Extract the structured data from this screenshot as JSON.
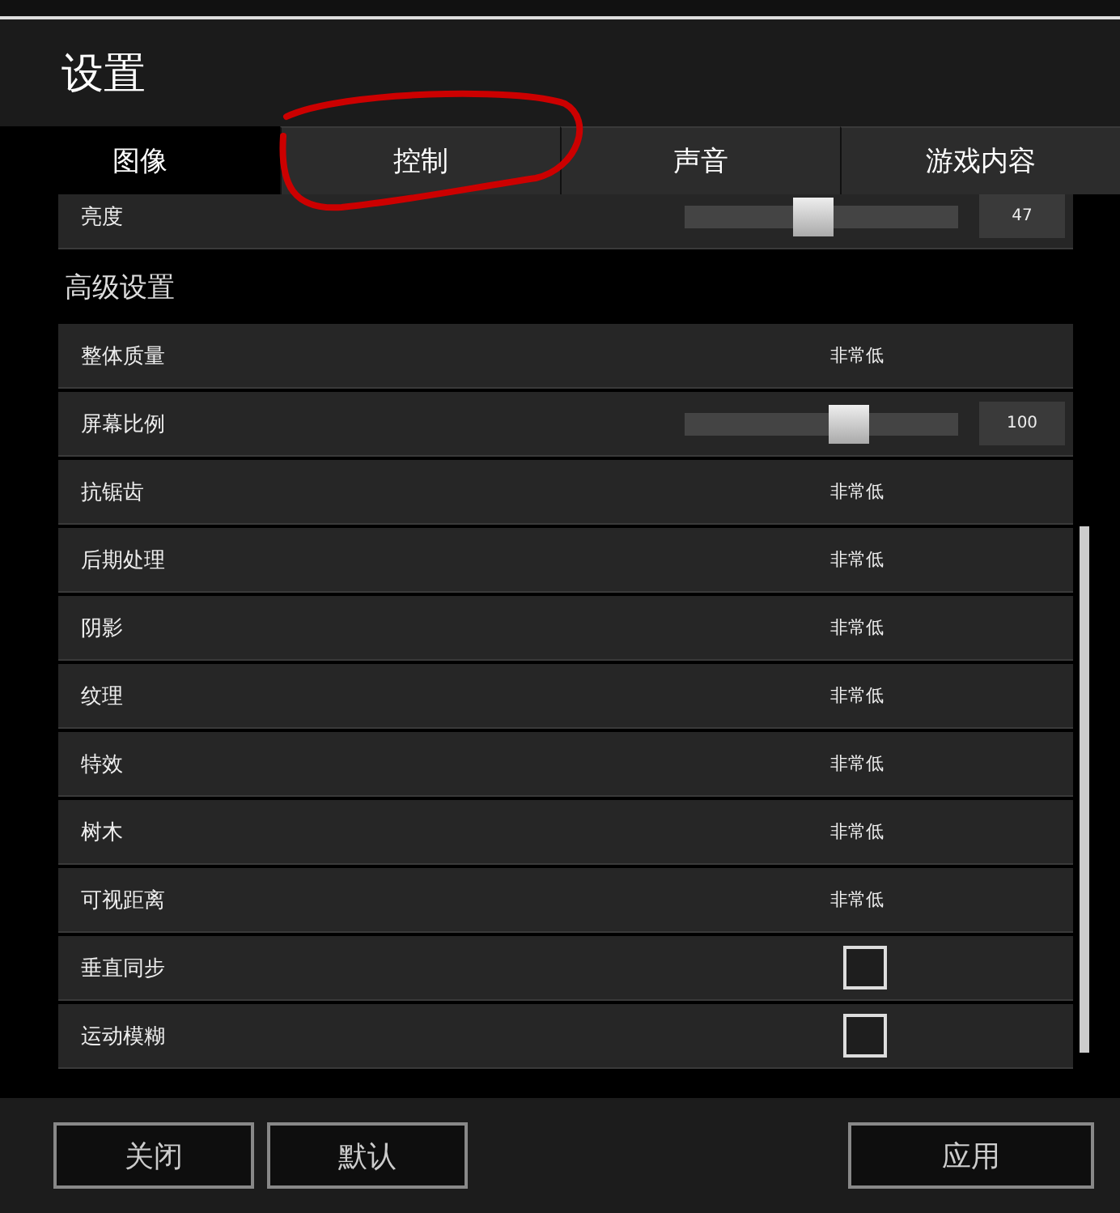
{
  "window": {
    "title": "设置"
  },
  "tabs": [
    {
      "label": "图像",
      "selected": true,
      "circled": false
    },
    {
      "label": "控制",
      "selected": false,
      "circled": true
    },
    {
      "label": "声音",
      "selected": false,
      "circled": false
    },
    {
      "label": "游戏内容",
      "selected": false,
      "circled": false
    }
  ],
  "settings": [
    {
      "kind": "slider",
      "name": "亮度",
      "level": 0.47,
      "reading": "47"
    }
  ],
  "section": "高级设置",
  "advanced": [
    {
      "kind": "value",
      "name": "整体质量",
      "value": "非常低"
    },
    {
      "kind": "slider",
      "name": "屏幕比例",
      "level": 0.6,
      "reading": "100"
    },
    {
      "kind": "value",
      "name": "抗锯齿",
      "value": "非常低"
    },
    {
      "kind": "value",
      "name": "后期处理",
      "value": "非常低"
    },
    {
      "kind": "value",
      "name": "阴影",
      "value": "非常低"
    },
    {
      "kind": "value",
      "name": "纹理",
      "value": "非常低"
    },
    {
      "kind": "value",
      "name": "特效",
      "value": "非常低"
    },
    {
      "kind": "value",
      "name": "树木",
      "value": "非常低"
    },
    {
      "kind": "value",
      "name": "可视距离",
      "value": "非常低"
    },
    {
      "kind": "checkbox",
      "name": "垂直同步",
      "checked": false
    },
    {
      "kind": "checkbox",
      "name": "运动模糊",
      "checked": false
    }
  ],
  "buttons": [
    "关闭",
    "默认",
    "应用"
  ]
}
